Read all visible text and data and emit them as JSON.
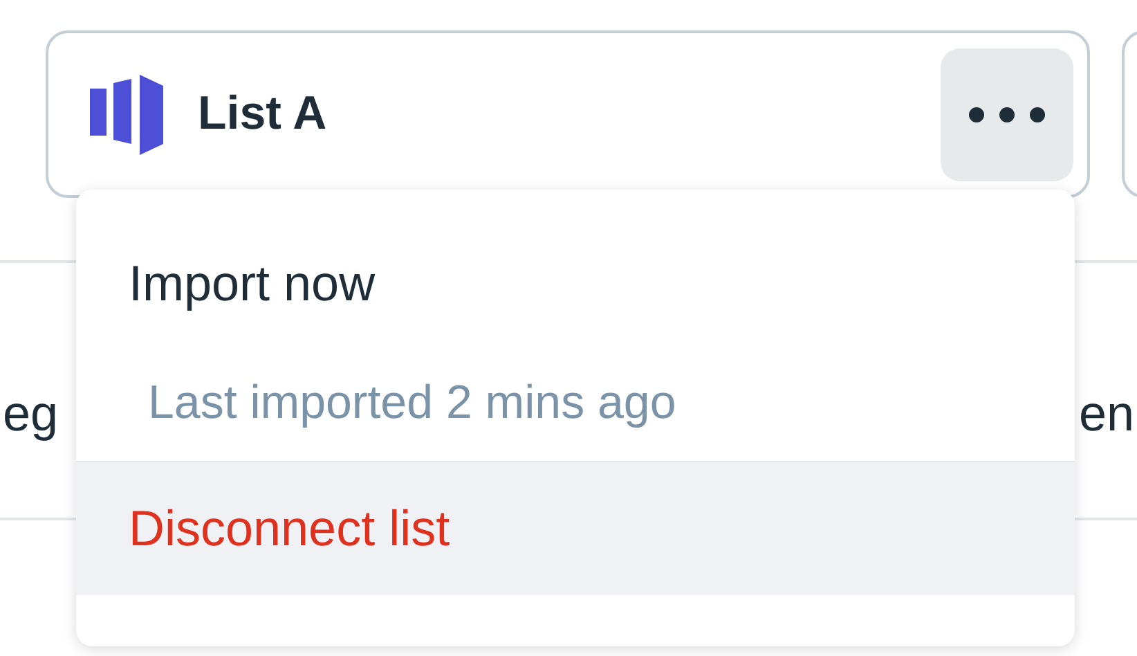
{
  "card": {
    "title": "List A",
    "menu_open": true
  },
  "background_row": {
    "column_1": "eg",
    "column_2": "en"
  },
  "menu": {
    "items": [
      {
        "kind": "action",
        "label": "Import now",
        "highlighted": false
      },
      {
        "kind": "note",
        "label": "Last imported 2 mins ago",
        "highlighted": false
      },
      {
        "kind": "danger",
        "label": "Disconnect list",
        "highlighted": true
      }
    ]
  }
}
